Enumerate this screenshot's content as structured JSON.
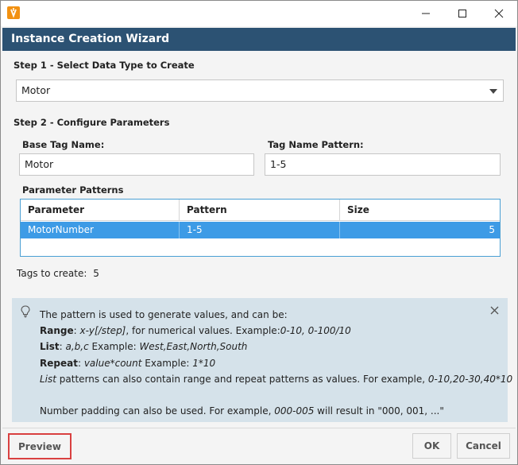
{
  "window": {
    "icon": "ignition-app-icon",
    "controls": [
      "minimize-icon",
      "maximize-icon",
      "close-icon"
    ]
  },
  "header": {
    "title": "Instance Creation Wizard"
  },
  "step1": {
    "label": "Step 1 - Select Data Type to Create",
    "data_type": "Motor"
  },
  "step2": {
    "label": "Step 2 - Configure Parameters",
    "base_tag_label": "Base Tag Name:",
    "base_tag_value": "Motor",
    "pattern_label": "Tag Name Pattern:",
    "pattern_value": "1-5",
    "table_title": "Parameter Patterns",
    "columns": [
      "Parameter",
      "Pattern",
      "Size"
    ],
    "rows": [
      {
        "parameter": "MotorNumber",
        "pattern": "1-5",
        "size": "5"
      }
    ]
  },
  "tags": {
    "label": "Tags to create:",
    "count": "5"
  },
  "info": {
    "intro": "The pattern is used to generate values, and can be:",
    "range_label": "Range",
    "range_syntax": "x-y[/step]",
    "range_text1": ", for numerical values. Example:",
    "range_ex": "0-10, 0-100/10",
    "list_label": "List",
    "list_syntax": "a,b,c",
    "list_text1": " Example: ",
    "list_ex": "West,East,North,South",
    "repeat_label": "Repeat",
    "repeat_syntax": "value*count",
    "repeat_text1": " Example: ",
    "repeat_ex": "1*10",
    "list_word": "List",
    "nested_text": " patterns can also contain range and repeat patterns as values. For example, ",
    "nested_ex": "0-10,20-30,40*10",
    "padding_text1": "Number padding can also be used. For example, ",
    "padding_ex": "000-005",
    "padding_text2": " will result in \"000, 001, ...\""
  },
  "buttons": {
    "preview": "Preview",
    "ok": "OK",
    "cancel": "Cancel"
  }
}
